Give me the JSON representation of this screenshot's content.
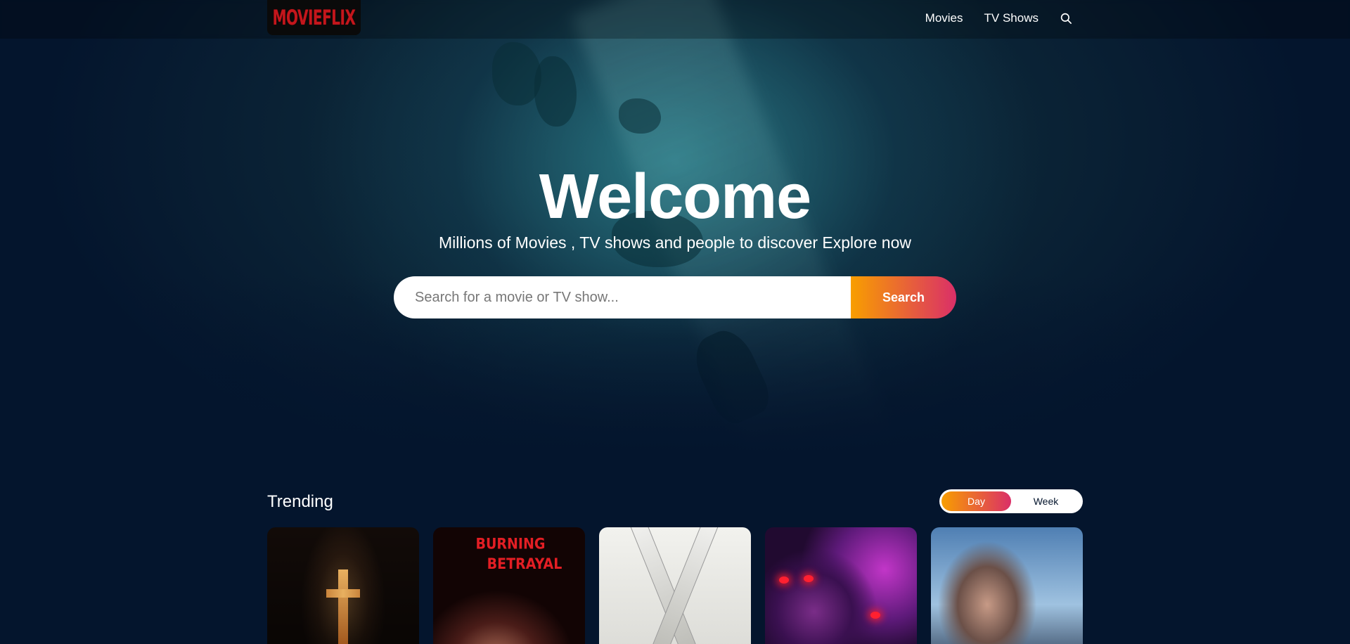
{
  "header": {
    "logo_text": "MOVIEFLIX",
    "nav": {
      "movies_label": "Movies",
      "tv_shows_label": "TV Shows"
    }
  },
  "hero": {
    "title": "Welcome",
    "subtitle": "Millions of Movies , TV shows and people to discover Explore now",
    "search_placeholder": "Search for a movie or TV show...",
    "search_button_label": "Search"
  },
  "trending": {
    "title": "Trending",
    "tabs": [
      {
        "label": "Day",
        "active": true
      },
      {
        "label": "Week",
        "active": false
      }
    ],
    "posters": [
      {
        "caption": ""
      },
      {
        "caption": "BURNING BETRAYAL"
      },
      {
        "caption": ""
      },
      {
        "caption": ""
      },
      {
        "caption": ""
      }
    ]
  },
  "colors": {
    "background": "#04152d",
    "gradient_start": "#f89e00",
    "gradient_end": "#da2f68",
    "logo_red": "#c4161c"
  },
  "icons": {
    "search": "search-icon"
  }
}
